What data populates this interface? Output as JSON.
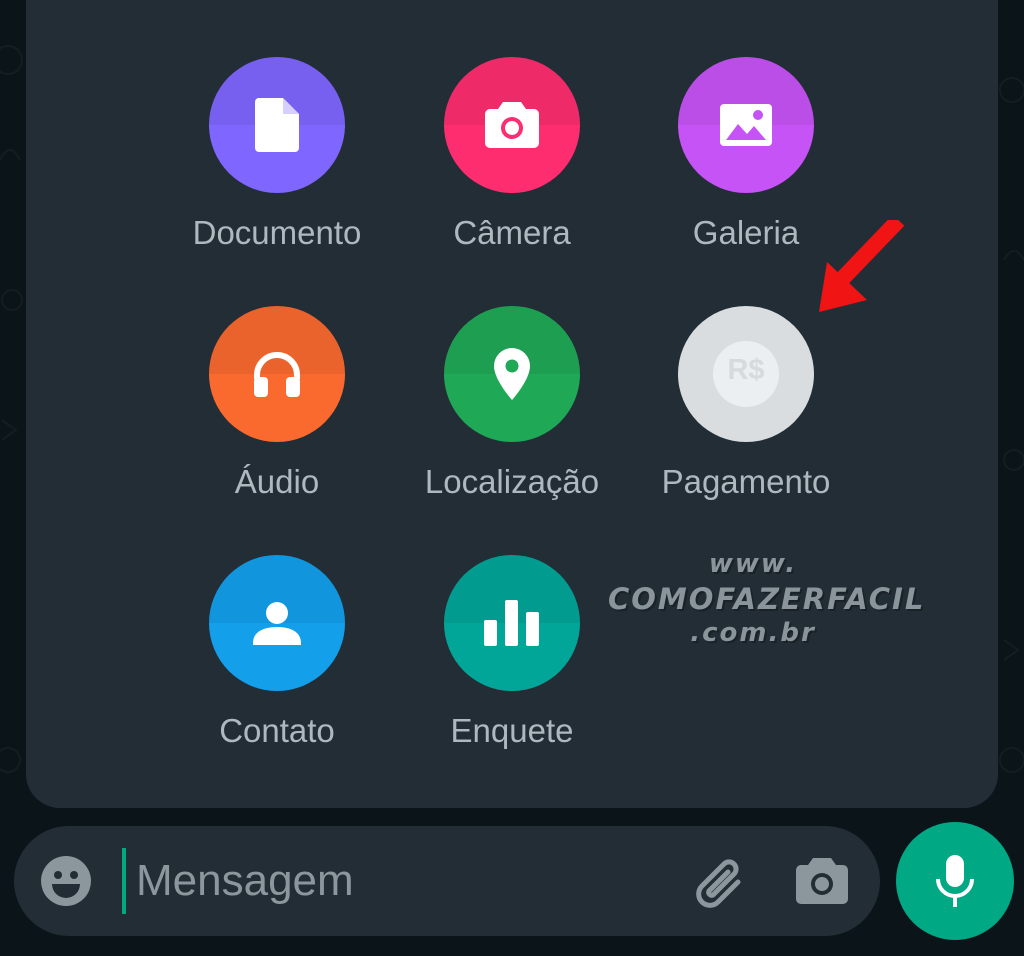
{
  "attach_menu": {
    "items": [
      {
        "label": "Documento",
        "icon": "document-icon",
        "color": "#7f66ff"
      },
      {
        "label": "Câmera",
        "icon": "camera-icon",
        "color": "#fd2d70"
      },
      {
        "label": "Galeria",
        "icon": "gallery-icon",
        "color": "#c653f5"
      },
      {
        "label": "Áudio",
        "icon": "headphones-icon",
        "color": "#fa6a2f"
      },
      {
        "label": "Localização",
        "icon": "location-pin-icon",
        "color": "#1fa855"
      },
      {
        "label": "Pagamento",
        "icon": "payment-icon",
        "color": "#d9dde0",
        "icon_text": "R$"
      },
      {
        "label": "Contato",
        "icon": "contact-icon",
        "color": "#139fea"
      },
      {
        "label": "Enquete",
        "icon": "poll-icon",
        "color": "#02a698"
      }
    ]
  },
  "watermark": {
    "line1": "www.",
    "line2": "COMOFAZERFACIL",
    "line3": ".com.br"
  },
  "composer": {
    "placeholder": "Mensagem",
    "accent": "#00a884"
  }
}
